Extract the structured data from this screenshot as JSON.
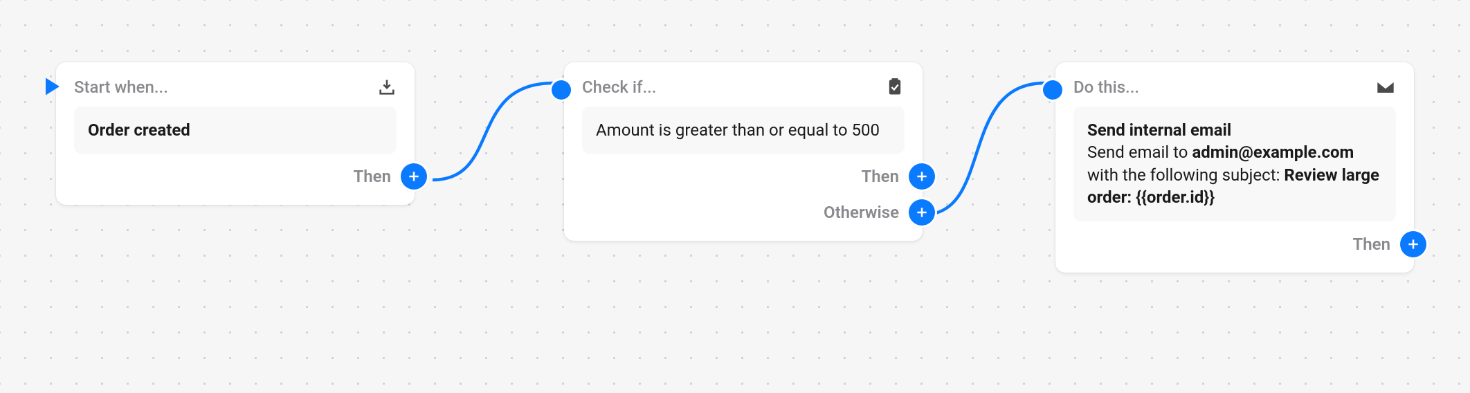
{
  "colors": {
    "accent": "#0a7aff"
  },
  "start": {
    "header_label": "Start when...",
    "body": "Order created",
    "outlets": {
      "then": "Then"
    },
    "icon": "download-tray-icon"
  },
  "condition": {
    "header_label": "Check if...",
    "body": "Amount is greater than or equal to 500",
    "outlets": {
      "then": "Then",
      "otherwise": "Otherwise"
    },
    "icon": "clipboard-check-icon"
  },
  "action": {
    "header_label": "Do this...",
    "body": {
      "title": "Send internal email",
      "prefix": "Send email to ",
      "email": "admin@example.com",
      "mid": " with the following subject: ",
      "subject": "Review large order: {{order.id}}"
    },
    "outlets": {
      "then": "Then"
    },
    "icon": "mail-icon"
  }
}
